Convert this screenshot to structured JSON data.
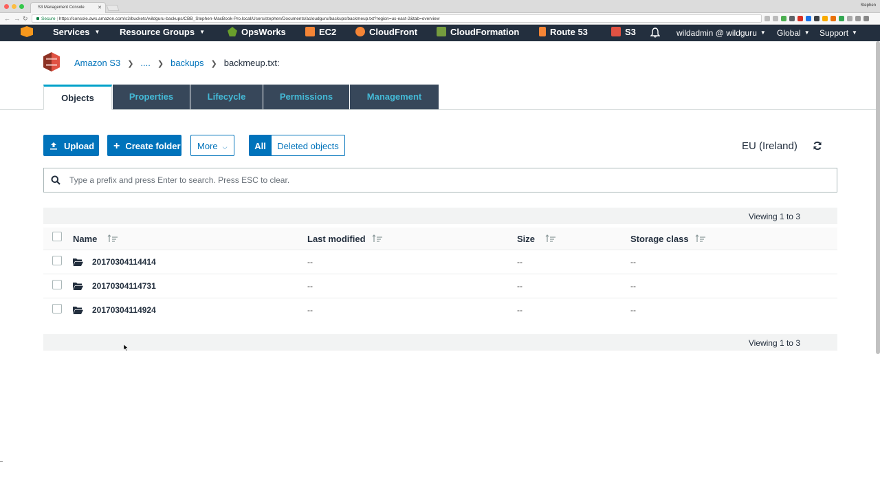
{
  "browser": {
    "tab_title": "S3 Management Console",
    "profile": "Stephen",
    "secure_label": "Secure",
    "url": "https://console.aws.amazon.com/s3/buckets/wildguru-backups/CBB_Stephen-MacBook-Pro.local/Users/stephen/Documents/acloudguru/backups/backmeup.txt?region=us-east-2&tab=overview"
  },
  "nav": {
    "services": "Services",
    "resource_groups": "Resource Groups",
    "shortcuts": [
      {
        "label": "OpsWorks",
        "icon": "opsworks-icon",
        "color": "#6aa02c"
      },
      {
        "label": "EC2",
        "icon": "ec2-icon",
        "color": "#f58536"
      },
      {
        "label": "CloudFront",
        "icon": "cloudfront-icon",
        "color": "#f58536"
      },
      {
        "label": "CloudFormation",
        "icon": "cloudformation-icon",
        "color": "#759c3e"
      },
      {
        "label": "Route 53",
        "icon": "route53-icon",
        "color": "#f58536"
      },
      {
        "label": "S3",
        "icon": "s3-icon",
        "color": "#e05243"
      }
    ],
    "account": "wildadmin @ wildguru",
    "region": "Global",
    "support": "Support"
  },
  "breadcrumb": {
    "root": "Amazon S3",
    "ellipsis": "....",
    "folder": "backups",
    "current": "backmeup.txt:"
  },
  "tabs": [
    "Objects",
    "Properties",
    "Lifecycle",
    "Permissions",
    "Management"
  ],
  "toolbar": {
    "upload": "Upload",
    "create_folder": "Create folder",
    "more": "More",
    "all": "All",
    "deleted_objects": "Deleted objects",
    "region": "EU (Ireland)"
  },
  "search": {
    "placeholder": "Type a prefix and press Enter to search. Press ESC to clear."
  },
  "table": {
    "viewing_top": "Viewing 1 to 3",
    "viewing_bottom": "Viewing 1 to 3",
    "columns": [
      "Name",
      "Last modified",
      "Size",
      "Storage class"
    ],
    "rows": [
      {
        "name": "20170304114414",
        "last_modified": "--",
        "size": "--",
        "storage_class": "--"
      },
      {
        "name": "20170304114731",
        "last_modified": "--",
        "size": "--",
        "storage_class": "--"
      },
      {
        "name": "20170304114924",
        "last_modified": "--",
        "size": "--",
        "storage_class": "--"
      }
    ]
  },
  "colors": {
    "aws_nav": "#232f3e",
    "primary_blue": "#0073bb",
    "tab_inactive": "#37475a",
    "tab_text": "#44b9d6",
    "tab_active_border": "#00a1c9",
    "s3_red": "#e05243"
  }
}
